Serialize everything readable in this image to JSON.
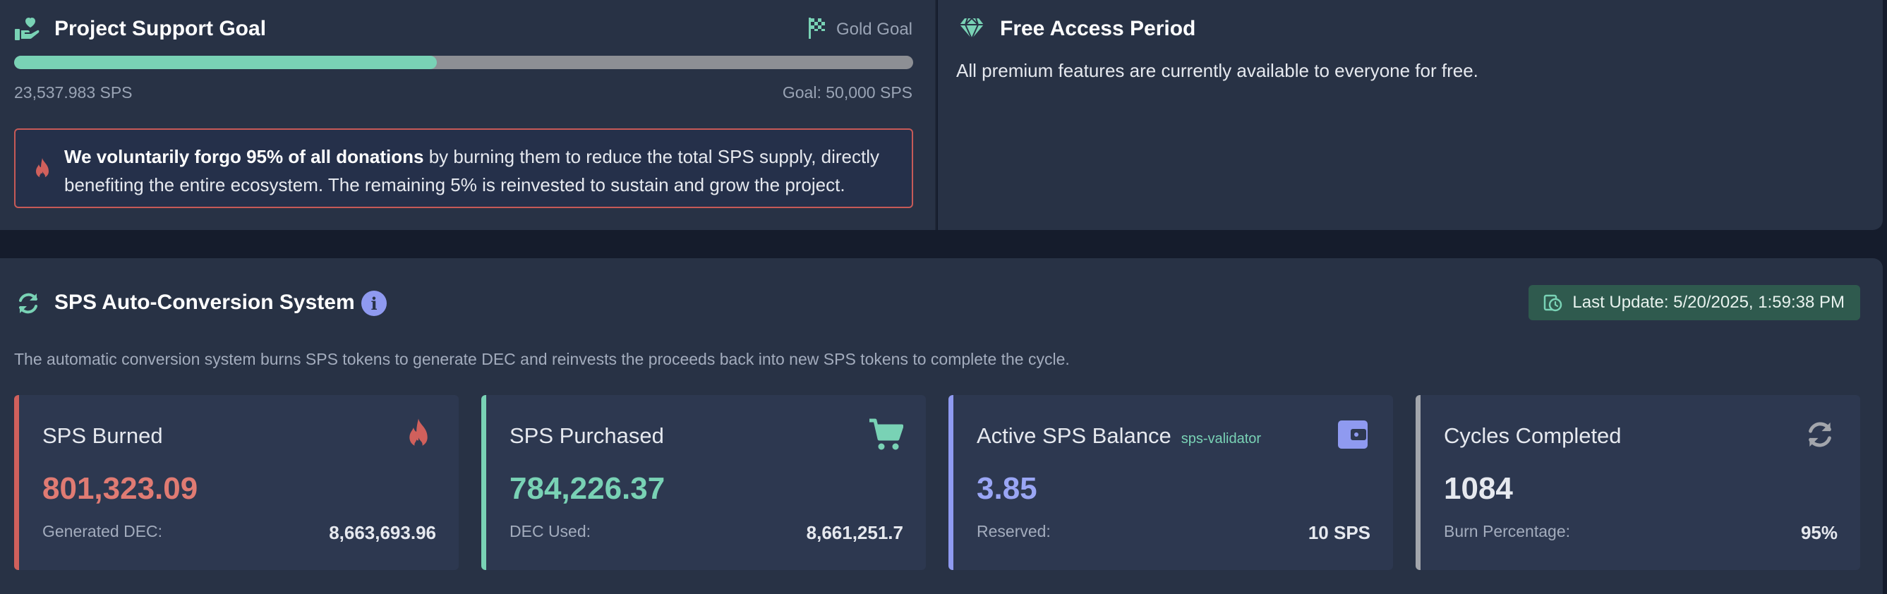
{
  "goal": {
    "title": "Project Support Goal",
    "tier_label": "Gold Goal",
    "progress_fraction": 0.47,
    "raised": "23,537.983 SPS",
    "target": "Goal: 50,000 SPS",
    "notice_bold": "We voluntarily forgo 95% of all donations",
    "notice_rest": " by burning them to reduce the total SPS supply, directly benefiting the entire ecosystem. The remaining 5% is reinvested to sustain and grow the project."
  },
  "free_access": {
    "title": "Free Access Period",
    "description": "All premium features are currently available to everyone for free."
  },
  "system": {
    "title": "SPS Auto-Conversion System",
    "info_symbol": "i",
    "last_update": "Last Update: 5/20/2025, 1:59:38 PM",
    "description": "The automatic conversion system burns SPS tokens to generate DEC and reinvests the proceeds back into new SPS tokens to complete the cycle."
  },
  "cards": [
    {
      "label": "SPS Burned",
      "tag": "",
      "value": "801,323.09",
      "sublabel": "Generated DEC:",
      "subvalue": "8,663,693.96",
      "icon": "fire-icon",
      "accent": "#d0605c",
      "value_color": "#e07b73"
    },
    {
      "label": "SPS Purchased",
      "tag": "",
      "value": "784,226.37",
      "sublabel": "DEC Used:",
      "subvalue": "8,661,251.7",
      "icon": "cart-icon",
      "accent": "#79d2b5",
      "value_color": "#79d2b5"
    },
    {
      "label": "Active SPS Balance",
      "tag": "sps-validator",
      "value": "3.85",
      "sublabel": "Reserved:",
      "subvalue": "10 SPS",
      "icon": "wallet-icon",
      "accent": "#8f9af0",
      "value_color": "#9aa6f5"
    },
    {
      "label": "Cycles Completed",
      "tag": "",
      "value": "1084",
      "sublabel": "Burn Percentage:",
      "subvalue": "95%",
      "icon": "sync-icon",
      "accent": "#a3a6ac",
      "value_color": "#e6e9ef"
    }
  ],
  "colors": {
    "background": "#151c2c",
    "panel": "#283245",
    "card": "#2d3850",
    "accent_green": "#79d2b5",
    "accent_red": "#c75a57",
    "accent_purple": "#8f9af0"
  }
}
